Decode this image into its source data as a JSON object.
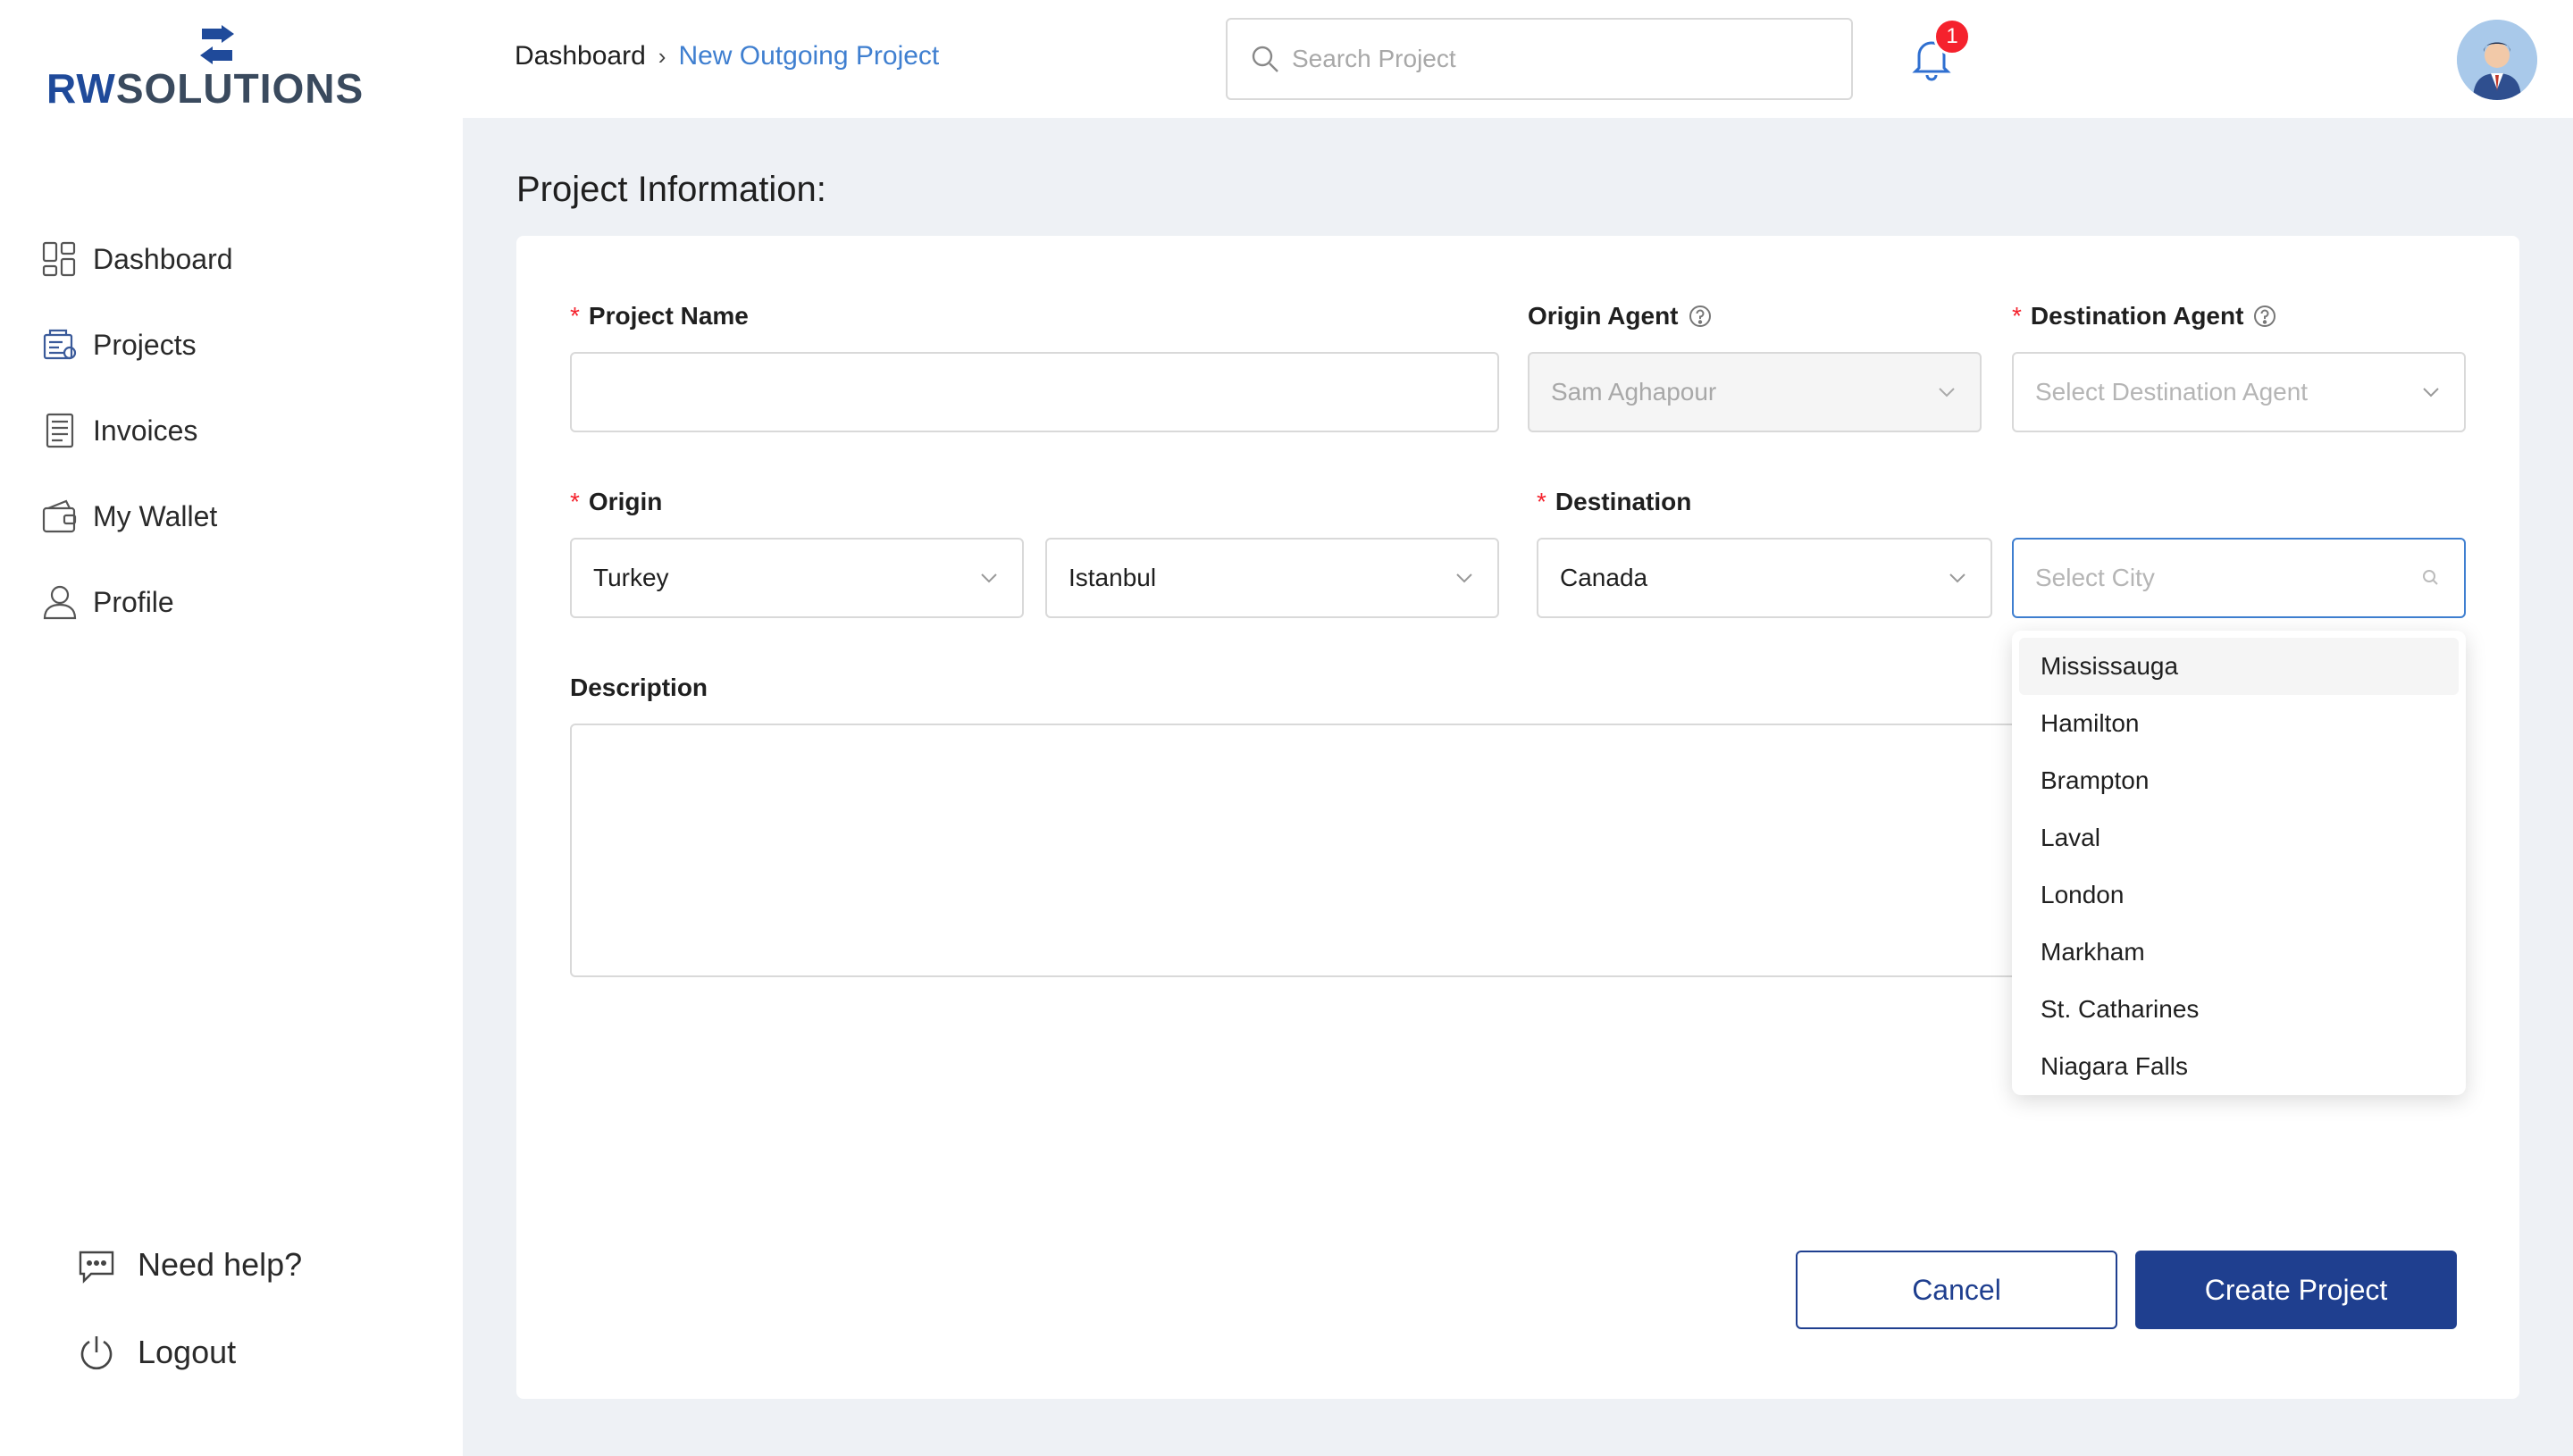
{
  "brand": {
    "logo_prefix": "RW",
    "logo_suffix": "SOLUTIONS",
    "brand_color": "#1f4a9a"
  },
  "sidebar": {
    "items": [
      {
        "label": "Dashboard",
        "icon": "dashboard-icon"
      },
      {
        "label": "Projects",
        "icon": "projects-icon"
      },
      {
        "label": "Invoices",
        "icon": "invoices-icon"
      },
      {
        "label": "My Wallet",
        "icon": "wallet-icon"
      },
      {
        "label": "Profile",
        "icon": "profile-icon"
      }
    ],
    "help_label": "Need help?",
    "logout_label": "Logout"
  },
  "header": {
    "breadcrumb_home": "Dashboard",
    "breadcrumb_separator": "›",
    "breadcrumb_current": "New Outgoing Project",
    "search_placeholder": "Search Project",
    "notification_count": "1"
  },
  "form": {
    "section_title": "Project Information:",
    "required_mark": "*",
    "project_name": {
      "label": "Project Name",
      "value": ""
    },
    "origin_agent": {
      "label": "Origin Agent",
      "value": "Sam Aghapour"
    },
    "destination_agent": {
      "label": "Destination Agent",
      "placeholder": "Select Destination Agent"
    },
    "origin": {
      "label": "Origin",
      "country": "Turkey",
      "city": "Istanbul"
    },
    "destination": {
      "label": "Destination",
      "country": "Canada",
      "city_placeholder": "Select City"
    },
    "description": {
      "label": "Description",
      "value": ""
    },
    "city_options": [
      "Mississauga",
      "Hamilton",
      "Brampton",
      "Laval",
      "London",
      "Markham",
      "St. Catharines",
      "Niagara Falls"
    ],
    "cancel_label": "Cancel",
    "create_label": "Create Project"
  },
  "colors": {
    "primary": "#1f3f8f",
    "link": "#3f7fd0",
    "required": "#f5222d"
  }
}
